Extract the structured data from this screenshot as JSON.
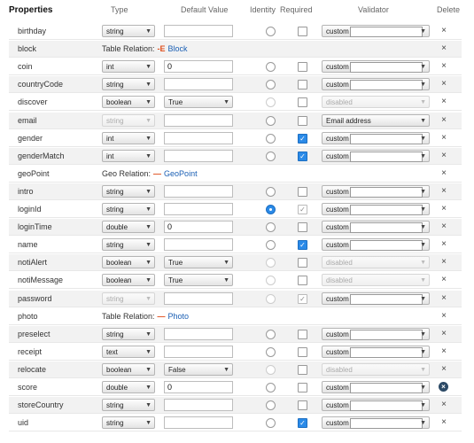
{
  "headers": {
    "properties": "Properties",
    "type": "Type",
    "default_value": "Default Value",
    "identity": "Identity",
    "required": "Required",
    "validator": "Validator",
    "delete": "Delete"
  },
  "rows": [
    {
      "name": "birthday",
      "kind": "field",
      "type": "string",
      "type_disabled": false,
      "default": {
        "kind": "input",
        "value": ""
      },
      "identity": "off",
      "required": "off",
      "validator": {
        "label": "custom",
        "disabled": false,
        "box": true
      },
      "delete": "×"
    },
    {
      "name": "block",
      "kind": "relation",
      "relation_label": "Table Relation:",
      "relation_icon": "-E",
      "relation_target": "Block",
      "delete": "×"
    },
    {
      "name": "coin",
      "kind": "field",
      "type": "int",
      "type_disabled": false,
      "default": {
        "kind": "input",
        "value": "0"
      },
      "identity": "off",
      "required": "off",
      "validator": {
        "label": "custom",
        "disabled": false,
        "box": true
      },
      "delete": "×"
    },
    {
      "name": "countryCode",
      "kind": "field",
      "type": "string",
      "type_disabled": false,
      "default": {
        "kind": "input",
        "value": ""
      },
      "identity": "off",
      "required": "off",
      "validator": {
        "label": "custom",
        "disabled": false,
        "box": true
      },
      "delete": "×"
    },
    {
      "name": "discover",
      "kind": "field",
      "type": "boolean",
      "type_disabled": false,
      "default": {
        "kind": "select",
        "value": "True"
      },
      "identity": "disabled",
      "required": "off",
      "validator": {
        "label": "disabled",
        "disabled": true,
        "box": false
      },
      "delete": "×"
    },
    {
      "name": "email",
      "kind": "field",
      "type": "string",
      "type_disabled": true,
      "default": {
        "kind": "input",
        "value": ""
      },
      "identity": "off",
      "required": "off",
      "validator": {
        "label": "Email address",
        "disabled": false,
        "box": false
      },
      "delete": "×"
    },
    {
      "name": "gender",
      "kind": "field",
      "type": "int",
      "type_disabled": false,
      "default": {
        "kind": "input",
        "value": ""
      },
      "identity": "off",
      "required": "on",
      "validator": {
        "label": "custom",
        "disabled": false,
        "box": true
      },
      "delete": "×"
    },
    {
      "name": "genderMatch",
      "kind": "field",
      "type": "int",
      "type_disabled": false,
      "default": {
        "kind": "input",
        "value": ""
      },
      "identity": "off",
      "required": "on",
      "validator": {
        "label": "custom",
        "disabled": false,
        "box": true
      },
      "delete": "×"
    },
    {
      "name": "geoPoint",
      "kind": "relation",
      "relation_label": "Geo Relation:",
      "relation_icon": "—",
      "relation_target": "GeoPoint",
      "delete": "×"
    },
    {
      "name": "intro",
      "kind": "field",
      "type": "string",
      "type_disabled": false,
      "default": {
        "kind": "input",
        "value": ""
      },
      "identity": "off",
      "required": "off",
      "validator": {
        "label": "custom",
        "disabled": false,
        "box": true
      },
      "delete": "×"
    },
    {
      "name": "loginId",
      "kind": "field",
      "type": "string",
      "type_disabled": false,
      "default": {
        "kind": "input",
        "value": ""
      },
      "identity": "on",
      "required": "grey",
      "validator": {
        "label": "custom",
        "disabled": false,
        "box": true
      },
      "delete": "×"
    },
    {
      "name": "loginTime",
      "kind": "field",
      "type": "double",
      "type_disabled": false,
      "default": {
        "kind": "input",
        "value": "0"
      },
      "identity": "off",
      "required": "off",
      "validator": {
        "label": "custom",
        "disabled": false,
        "box": true
      },
      "delete": "×"
    },
    {
      "name": "name",
      "kind": "field",
      "type": "string",
      "type_disabled": false,
      "default": {
        "kind": "input",
        "value": ""
      },
      "identity": "off",
      "required": "on",
      "validator": {
        "label": "custom",
        "disabled": false,
        "box": true
      },
      "delete": "×"
    },
    {
      "name": "notiAlert",
      "kind": "field",
      "type": "boolean",
      "type_disabled": false,
      "default": {
        "kind": "select",
        "value": "True"
      },
      "identity": "disabled",
      "required": "off",
      "validator": {
        "label": "disabled",
        "disabled": true,
        "box": false
      },
      "delete": "×"
    },
    {
      "name": "notiMessage",
      "kind": "field",
      "type": "boolean",
      "type_disabled": false,
      "default": {
        "kind": "select",
        "value": "True"
      },
      "identity": "disabled",
      "required": "off",
      "validator": {
        "label": "disabled",
        "disabled": true,
        "box": false
      },
      "delete": "×"
    },
    {
      "name": "password",
      "kind": "field",
      "type": "string",
      "type_disabled": true,
      "default": {
        "kind": "input",
        "value": ""
      },
      "identity": "disabled",
      "required": "grey",
      "validator": {
        "label": "custom",
        "disabled": false,
        "box": true
      },
      "delete": "×"
    },
    {
      "name": "photo",
      "kind": "relation",
      "relation_label": "Table Relation:",
      "relation_icon": "—",
      "relation_target": "Photo",
      "delete": "×"
    },
    {
      "name": "preselect",
      "kind": "field",
      "type": "string",
      "type_disabled": false,
      "default": {
        "kind": "input",
        "value": ""
      },
      "identity": "off",
      "required": "off",
      "validator": {
        "label": "custom",
        "disabled": false,
        "box": true
      },
      "delete": "×"
    },
    {
      "name": "receipt",
      "kind": "field",
      "type": "text",
      "type_disabled": false,
      "default": {
        "kind": "input",
        "value": ""
      },
      "identity": "off",
      "required": "off",
      "validator": {
        "label": "custom",
        "disabled": false,
        "box": true
      },
      "delete": "×"
    },
    {
      "name": "relocate",
      "kind": "field",
      "type": "boolean",
      "type_disabled": false,
      "default": {
        "kind": "select",
        "value": "False"
      },
      "identity": "disabled",
      "required": "off",
      "validator": {
        "label": "disabled",
        "disabled": true,
        "box": false
      },
      "delete": "×"
    },
    {
      "name": "score",
      "kind": "field",
      "type": "double",
      "type_disabled": false,
      "default": {
        "kind": "input",
        "value": "0"
      },
      "identity": "off",
      "required": "off",
      "validator": {
        "label": "custom",
        "disabled": false,
        "box": true
      },
      "delete": "×",
      "delete_hover": true
    },
    {
      "name": "storeCountry",
      "kind": "field",
      "type": "string",
      "type_disabled": false,
      "default": {
        "kind": "input",
        "value": ""
      },
      "identity": "off",
      "required": "off",
      "validator": {
        "label": "custom",
        "disabled": false,
        "box": true
      },
      "delete": "×"
    },
    {
      "name": "uid",
      "kind": "field",
      "type": "string",
      "type_disabled": false,
      "default": {
        "kind": "input",
        "value": ""
      },
      "identity": "off",
      "required": "on",
      "validator": {
        "label": "custom",
        "disabled": false,
        "box": true
      },
      "delete": "×"
    }
  ],
  "icons": {
    "dropdown": "chevron-down-icon",
    "check": "check-icon",
    "delete": "close-icon"
  },
  "colors": {
    "accent": "#2a8ae8",
    "relation_icon": "#e0501e",
    "link": "#1a5fb4",
    "row_alt": "#f2f2f2"
  }
}
